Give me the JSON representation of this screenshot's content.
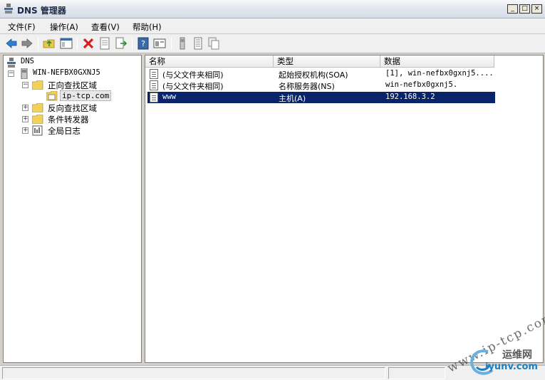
{
  "window": {
    "title": "DNS 管理器",
    "controls": [
      "_",
      "□",
      "×"
    ]
  },
  "menu": [
    "文件(F)",
    "操作(A)",
    "查看(V)",
    "帮助(H)"
  ],
  "toolbar": {
    "icons": [
      "back-arrow-icon",
      "forward-arrow-icon",
      "up-folder-icon",
      "show-hide-tree-icon",
      "delete-icon",
      "properties-icon",
      "export-icon",
      "help-icon",
      "console-icon",
      "server-icon",
      "records-icon",
      "copy-icon"
    ]
  },
  "tree": {
    "root": "DNS",
    "server": "WIN-NEFBX0GXNJ5",
    "forward_zone": "正向查找区域",
    "zone": "ip-tcp.com",
    "reverse_zone": "反向查找区域",
    "forwarders": "条件转发器",
    "global_log": "全局日志"
  },
  "list": {
    "columns": [
      "名称",
      "类型",
      "数据"
    ],
    "rows": [
      {
        "name": "(与父文件夹相同)",
        "type": "起始授权机构(SOA)",
        "data": "[1], win-nefbx0gxnj5....",
        "selected": false
      },
      {
        "name": "(与父文件夹相同)",
        "type": "名称服务器(NS)",
        "data": "win-nefbx0gxnj5.",
        "selected": false
      },
      {
        "name": "www",
        "type": "主机(A)",
        "data": "192.168.3.2",
        "selected": true
      }
    ]
  },
  "watermark": {
    "text": "www.ip-tcp.com",
    "logo_cn": "运维网",
    "logo_en": "iyunv.com"
  },
  "colors": {
    "selection": "#0a246a",
    "accent_blue": "#1e7fc1"
  }
}
